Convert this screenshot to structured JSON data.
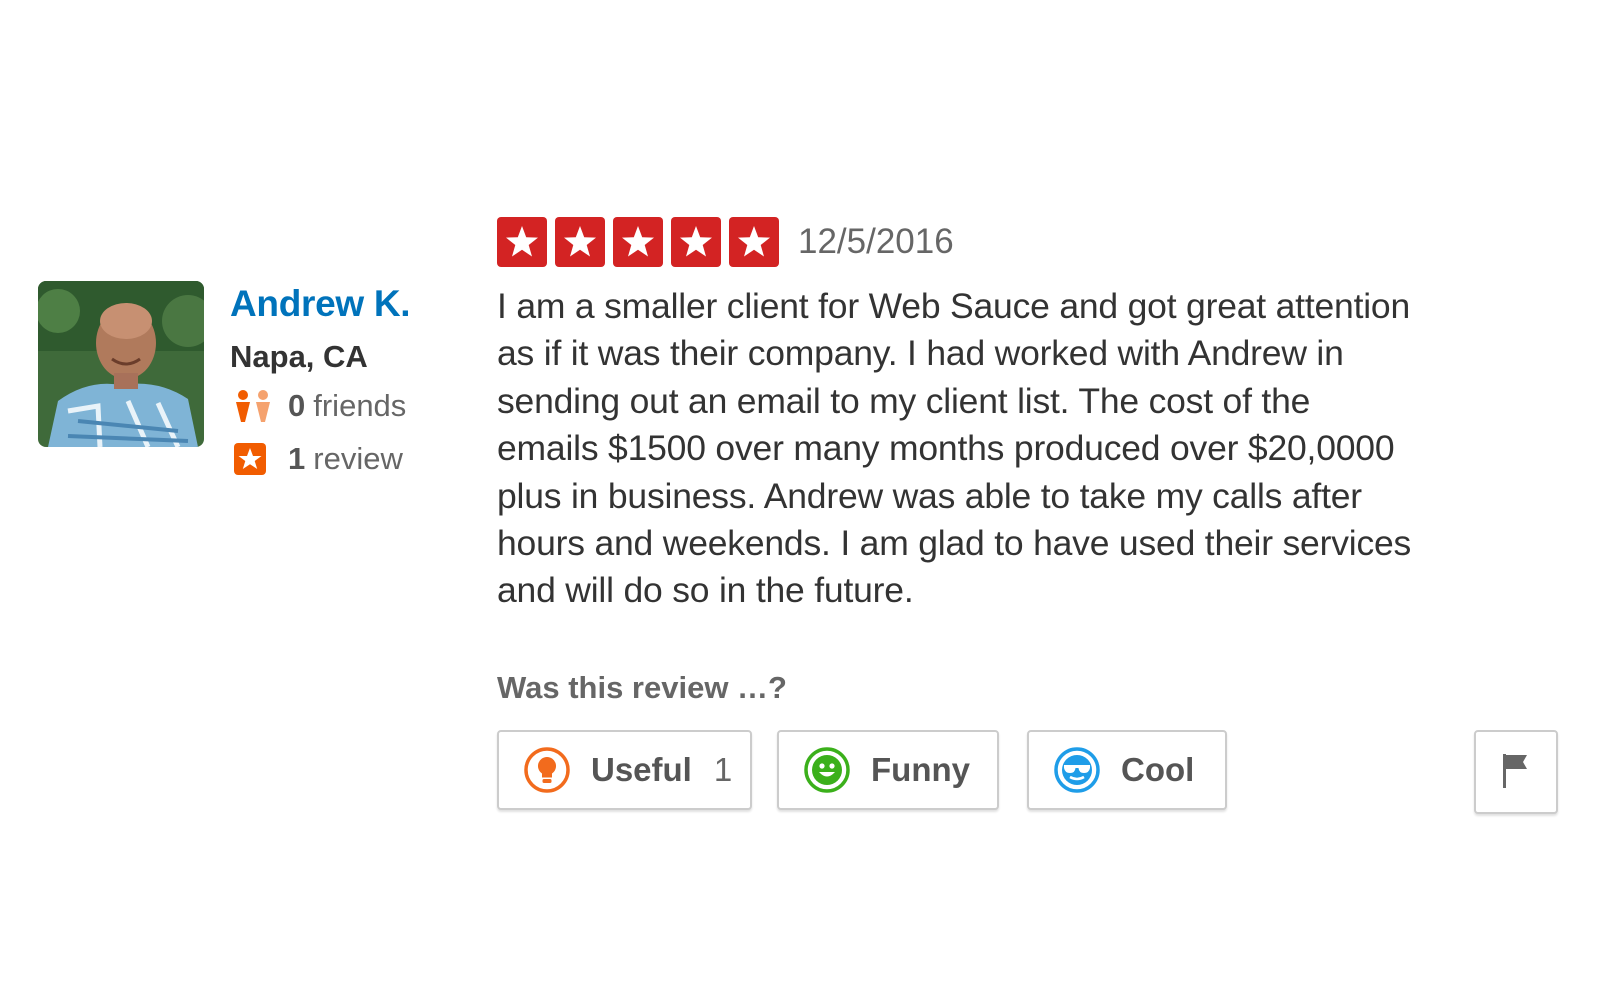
{
  "user": {
    "name": "Andrew K.",
    "location": "Napa, CA",
    "friends_count": "0",
    "friends_label": "friends",
    "reviews_count": "1",
    "reviews_label": "review"
  },
  "review": {
    "rating": 5,
    "max_rating": 5,
    "date": "12/5/2016",
    "text": "I am a smaller client for Web Sauce and got great attention\nas if it was their company. I had worked with Andrew in\nsending out an email to my client list. The cost of the\nemails $1500 over many  months produced over $20,0000\nplus in business. Andrew was able to take my calls after\nhours and weekends. I am glad to have used their services\nand will do so in the future."
  },
  "votes": {
    "prompt": "Was this review …?",
    "useful_label": "Useful",
    "useful_count": "1",
    "funny_label": "Funny",
    "cool_label": "Cool"
  },
  "icons": {
    "rating_star": "star-icon",
    "friends": "friends-icon",
    "review_count": "review-star-icon",
    "useful": "lightbulb-icon",
    "funny": "smiley-icon",
    "cool": "sunglasses-icon",
    "flag": "flag-icon"
  },
  "colors": {
    "star_red": "#d32323",
    "link_blue": "#0073bb",
    "orange": "#f15c00",
    "useful_orange": "#f26b1d",
    "funny_green": "#3bb01b",
    "cool_blue": "#1f9de8"
  }
}
